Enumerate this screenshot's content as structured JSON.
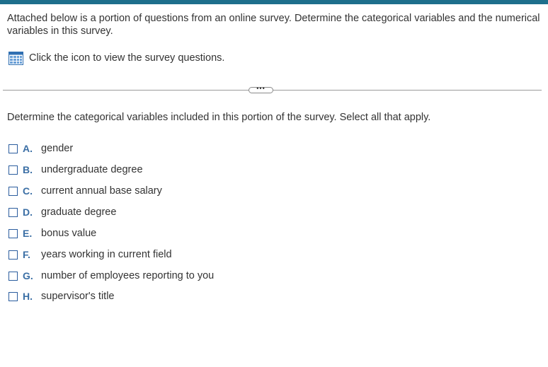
{
  "intro_text": "Attached below is a portion of questions from an online survey. Determine the categorical variables and the numerical variables in this survey.",
  "survey_link": {
    "label": "Click the icon to view the survey questions.",
    "icon": "table-grid-icon"
  },
  "expand_button": {
    "label": "•••"
  },
  "question_text": "Determine the categorical variables included in this portion of the survey. Select all that apply.",
  "options": [
    {
      "letter": "A.",
      "text": "gender"
    },
    {
      "letter": "B.",
      "text": "undergraduate degree"
    },
    {
      "letter": "C.",
      "text": "current annual base salary"
    },
    {
      "letter": "D.",
      "text": "graduate degree"
    },
    {
      "letter": "E.",
      "text": "bonus value"
    },
    {
      "letter": "F.",
      "text": "years working in current field"
    },
    {
      "letter": "G.",
      "text": "number of employees reporting to you"
    },
    {
      "letter": "H.",
      "text": "supervisor's title"
    }
  ],
  "colors": {
    "top_bar": "#1e6f8c",
    "accent": "#3b6fa5",
    "checkbox_border": "#2b5d9e"
  }
}
